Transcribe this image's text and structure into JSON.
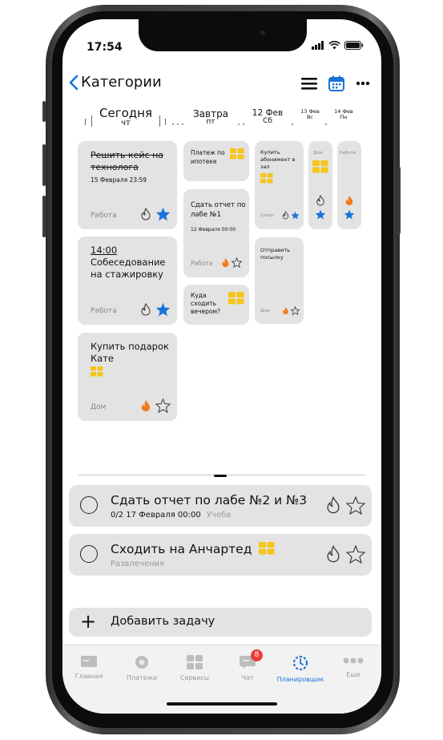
{
  "status": {
    "time": "17:54"
  },
  "nav": {
    "back_label": "Категории"
  },
  "days": [
    {
      "name": "Сегодня",
      "weekday": "чт"
    },
    {
      "name": "Завтра",
      "weekday": "пт"
    },
    {
      "name": "12 Фев",
      "weekday": "Сб"
    },
    {
      "name": "13 Фев",
      "weekday": "Вс"
    },
    {
      "name": "14 Фев",
      "weekday": "Пн"
    }
  ],
  "today_cards": [
    {
      "title": "Решить кейс на технолога",
      "date": "15 Февраля 23:59",
      "category": "Работа"
    },
    {
      "time": "14:00",
      "title": "Собеседование на стажировку",
      "category": "Работа"
    },
    {
      "title": "Купить подарок Кате",
      "category": "Дом"
    }
  ],
  "tomorrow_cards": [
    {
      "title": "Платеж по ипотеке"
    },
    {
      "title": "Сдать отчет по лабе №1",
      "date": "12 Февраля 00:00",
      "category": "Работа"
    },
    {
      "title": "Куда сходить вечером?"
    }
  ],
  "sat_cards": [
    {
      "title": "Купить абонимент в зал",
      "category": "Спорт"
    },
    {
      "title": "Отправить посылку",
      "category": "Дом"
    }
  ],
  "sun_cards": [
    {
      "category": "Дом"
    }
  ],
  "mon_cards": [
    {
      "category": "Работа"
    }
  ],
  "tasks": [
    {
      "title": "Сдать отчет по лабе №2 и №3",
      "progress": "0/2",
      "date": "17 Февраля 00:00",
      "category": "Учеба"
    },
    {
      "title": "Сходить на Анчартед",
      "category": "Развлечения"
    }
  ],
  "add_task_label": "Добавить задачу",
  "tabs": [
    {
      "label": "Главная"
    },
    {
      "label": "Платежи"
    },
    {
      "label": "Сервисы"
    },
    {
      "label": "Чат",
      "badge": "8"
    },
    {
      "label": "Планировщик"
    },
    {
      "label": "Еще"
    }
  ],
  "colors": {
    "accent": "#1a73d9",
    "star": "#1a73d9",
    "fire": "#f07a1a",
    "tag": "#f5c518",
    "badge": "#ef3a3a"
  },
  "icons": [
    "back-chevron-icon",
    "list-icon",
    "calendar-icon",
    "more-icon",
    "fire-icon",
    "star-icon",
    "tag-icon",
    "plus-icon"
  ]
}
